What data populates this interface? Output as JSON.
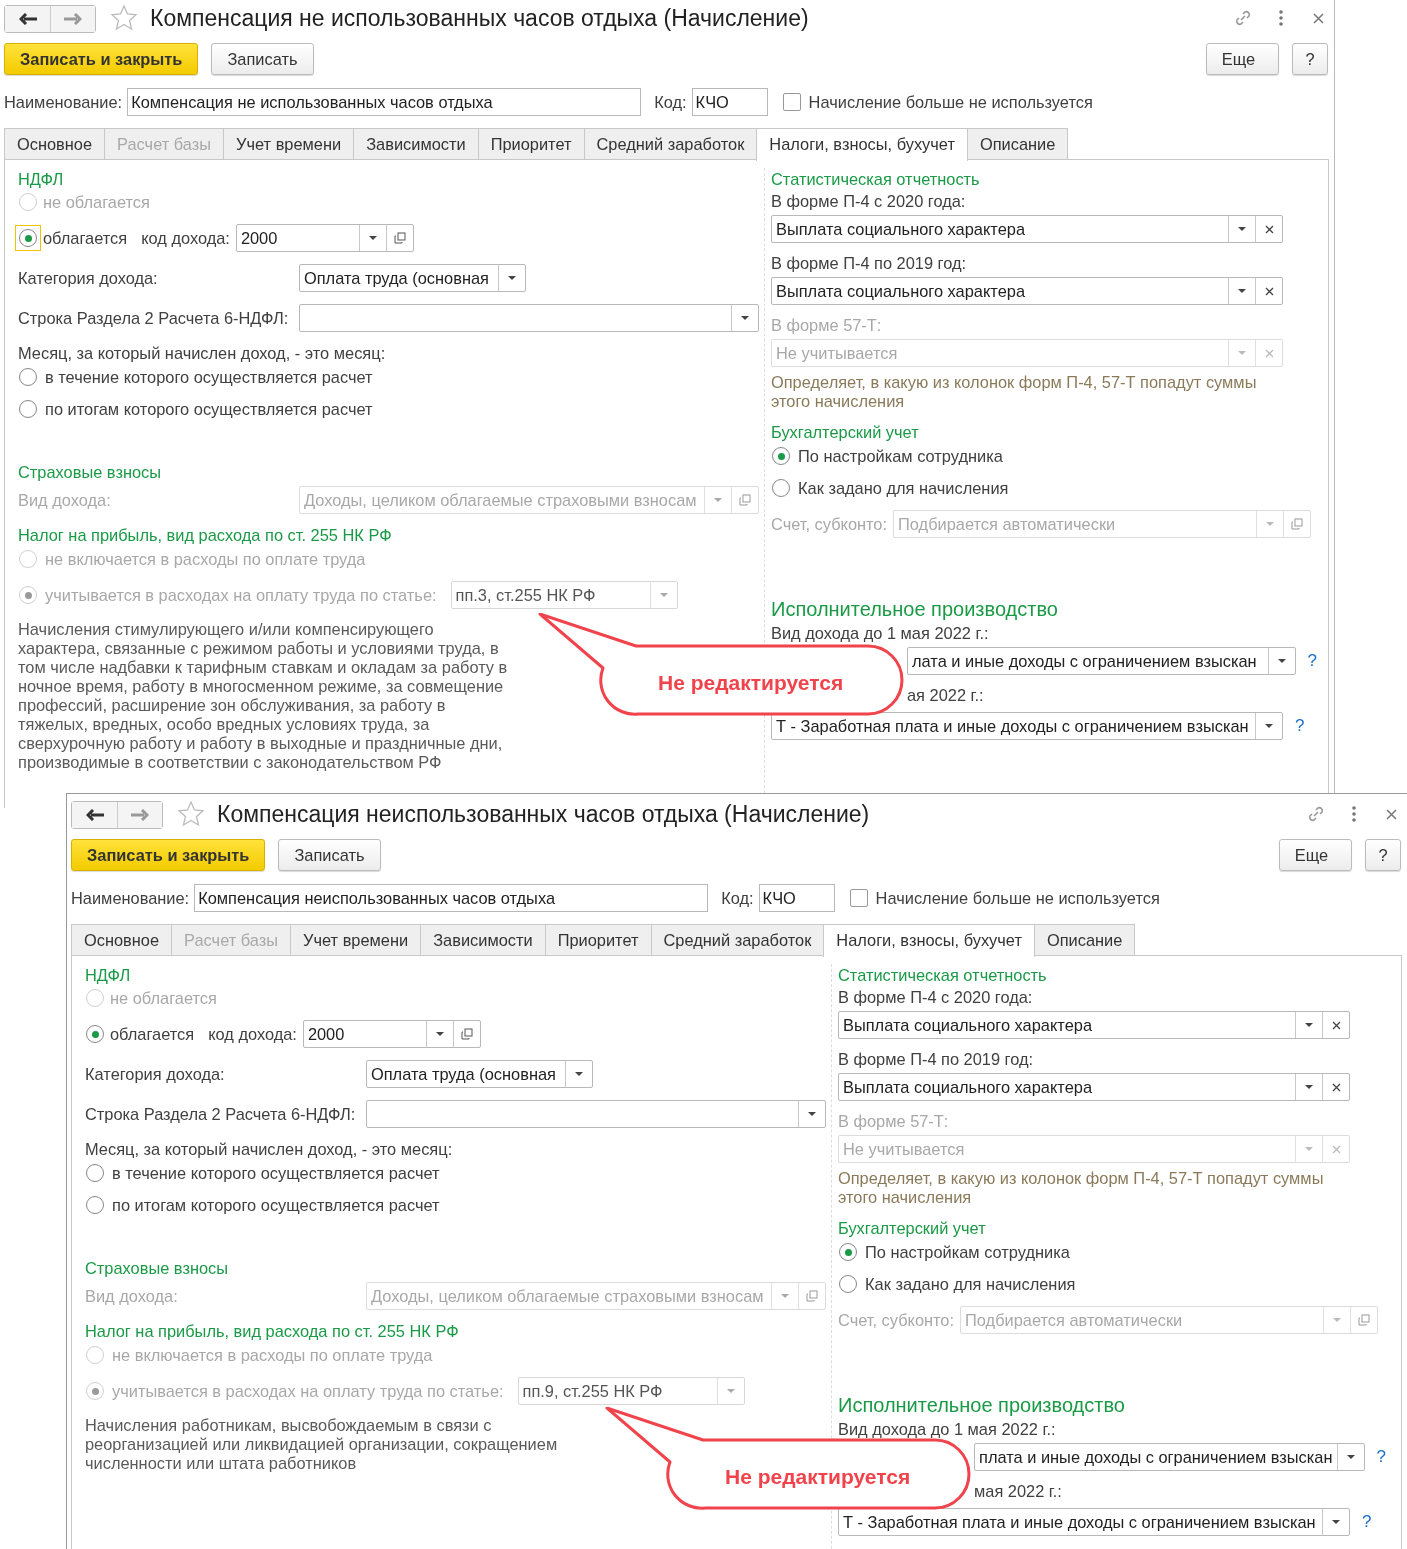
{
  "windows": [
    {
      "title": "Компенсация не использованных часов отдыха (Начисление)",
      "buttons": {
        "save_close": "Записать и закрыть",
        "save": "Записать",
        "more": "Еще",
        "help": "?"
      },
      "name": {
        "label": "Наименование:",
        "value": "Компенсация не использованных часов отдыха"
      },
      "code": {
        "label": "Код:",
        "value": "КЧО"
      },
      "not_used": {
        "label": "Начисление больше не используется",
        "checked": false
      },
      "tabs": [
        {
          "label": "Основное",
          "selected": false,
          "disabled": false
        },
        {
          "label": "Расчет базы",
          "selected": false,
          "disabled": true
        },
        {
          "label": "Учет времени",
          "selected": false,
          "disabled": false
        },
        {
          "label": "Зависимости",
          "selected": false,
          "disabled": false
        },
        {
          "label": "Приоритет",
          "selected": false,
          "disabled": false
        },
        {
          "label": "Средний заработок",
          "selected": false,
          "disabled": false
        },
        {
          "label": "Налоги, взносы, бухучет",
          "selected": true,
          "disabled": false
        },
        {
          "label": "Описание",
          "selected": false,
          "disabled": false
        }
      ],
      "ndfl": {
        "heading": "НДФЛ",
        "options": [
          {
            "label": "не облагается",
            "selected": false,
            "disabled": true,
            "focused": false
          },
          {
            "label": "облагается",
            "selected": true,
            "disabled": false,
            "focused": true
          }
        ],
        "income_code": {
          "label": "код дохода:",
          "value": "2000"
        },
        "category": {
          "label": "Категория дохода:",
          "value": "Оплата труда (основная"
        },
        "line": {
          "label": "Строка Раздела 2 Расчета 6-НДФЛ:"
        },
        "month": {
          "label": "Месяц, за который начислен доход, - это месяц:",
          "options": [
            {
              "label": "в течение которого осуществляется расчет",
              "selected": false
            },
            {
              "label": "по итогам которого осуществляется расчет",
              "selected": false
            }
          ]
        }
      },
      "insurance": {
        "heading": "Страховые взносы",
        "label": "Вид дохода:",
        "value": "Доходы, целиком облагаемые страховыми взносам"
      },
      "profit_tax": {
        "heading": "Налог на прибыль, вид расхода по ст. 255 НК РФ",
        "options": [
          {
            "label": "не включается в расходы по оплате труда",
            "selected": false,
            "disabled": true
          },
          {
            "label": "учитывается в расходах на оплату труда по статье:",
            "selected": true,
            "disabled": true
          }
        ],
        "article": "пп.3, ст.255 НК РФ",
        "description": "Начисления стимулирующего и/или компенсирующего характера, связанные с режимом работы и условиями труда, в том числе надбавки к тарифным ставкам и окладам за работу в ночное время, работу в многосменном режиме, за совмещение профессий, расширение зон обслуживания, за работу в тяжелых, вредных, особо вредных условиях труда, за сверхурочную работу и работу в выходные и праздничные дни, производимые в соответствии с законодательством РФ"
      },
      "stats": {
        "heading": "Статистическая отчетность",
        "fields": [
          {
            "label": "В форме П-4 с 2020 года:",
            "value": "Выплата социального характера",
            "disabled": false
          },
          {
            "label": "В форме П-4 по 2019 год:",
            "value": "Выплата социального характера",
            "disabled": false
          },
          {
            "label": "В форме 57-Т:",
            "value": "Не учитывается",
            "disabled": true
          }
        ],
        "note": "Определяет, в какую из колонок форм П-4, 57-Т попадут суммы этого начисления"
      },
      "accounting": {
        "heading": "Бухгалтерский учет",
        "options": [
          {
            "label": "По настройкам сотрудника",
            "selected": true
          },
          {
            "label": "Как задано для начисления",
            "selected": false
          }
        ],
        "account": {
          "label": "Счет, субконто:",
          "value": "Подбирается автоматически",
          "disabled": true
        }
      },
      "enforcement": {
        "heading": "Исполнительное производство",
        "fields": [
          {
            "label": "Вид дохода до 1 мая 2022 г.:",
            "value": "лата и иные доходы с ограничением взыскан",
            "help": "?"
          },
          {
            "label": "ая 2022 г.:",
            "value": "Т - Заработная плата и иные доходы с ограничением взыскан",
            "help": "?"
          }
        ]
      },
      "callout": "Не редактируется"
    },
    {
      "title": "Компенсация неиспользованных часов отдыха (Начисление)",
      "buttons": {
        "save_close": "Записать и закрыть",
        "save": "Записать",
        "more": "Еще",
        "help": "?"
      },
      "name": {
        "label": "Наименование:",
        "value": "Компенсация неиспользованных часов отдыха"
      },
      "code": {
        "label": "Код:",
        "value": "КЧО"
      },
      "not_used": {
        "label": "Начисление больше не используется",
        "checked": false
      },
      "tabs": [
        {
          "label": "Основное",
          "selected": false,
          "disabled": false
        },
        {
          "label": "Расчет базы",
          "selected": false,
          "disabled": true
        },
        {
          "label": "Учет времени",
          "selected": false,
          "disabled": false
        },
        {
          "label": "Зависимости",
          "selected": false,
          "disabled": false
        },
        {
          "label": "Приоритет",
          "selected": false,
          "disabled": false
        },
        {
          "label": "Средний заработок",
          "selected": false,
          "disabled": false
        },
        {
          "label": "Налоги, взносы, бухучет",
          "selected": true,
          "disabled": false
        },
        {
          "label": "Описание",
          "selected": false,
          "disabled": false
        }
      ],
      "ndfl": {
        "heading": "НДФЛ",
        "options": [
          {
            "label": "не облагается",
            "selected": false,
            "disabled": true,
            "focused": false
          },
          {
            "label": "облагается",
            "selected": true,
            "disabled": false,
            "focused": false
          }
        ],
        "income_code": {
          "label": "код дохода:",
          "value": "2000"
        },
        "category": {
          "label": "Категория дохода:",
          "value": "Оплата труда (основная"
        },
        "line": {
          "label": "Строка Раздела 2 Расчета 6-НДФЛ:"
        },
        "month": {
          "label": "Месяц, за который начислен доход, - это месяц:",
          "options": [
            {
              "label": "в течение которого осуществляется расчет",
              "selected": false
            },
            {
              "label": "по итогам которого осуществляется расчет",
              "selected": false
            }
          ]
        }
      },
      "insurance": {
        "heading": "Страховые взносы",
        "label": "Вид дохода:",
        "value": "Доходы, целиком облагаемые страховыми взносам"
      },
      "profit_tax": {
        "heading": "Налог на прибыль, вид расхода по ст. 255 НК РФ",
        "options": [
          {
            "label": "не включается в расходы по оплате труда",
            "selected": false,
            "disabled": true
          },
          {
            "label": "учитывается в расходах на оплату труда по статье:",
            "selected": true,
            "disabled": true
          }
        ],
        "article": "пп.9, ст.255 НК РФ",
        "description": "Начисления работникам, высвобождаемым в связи с реорганизацией или ликвидацией организации, сокращением численности или штата работников"
      },
      "stats": {
        "heading": "Статистическая отчетность",
        "fields": [
          {
            "label": "В форме П-4 с 2020 года:",
            "value": "Выплата социального характера",
            "disabled": false
          },
          {
            "label": "В форме П-4 по 2019 год:",
            "value": "Выплата социального характера",
            "disabled": false
          },
          {
            "label": "В форме 57-Т:",
            "value": "Не учитывается",
            "disabled": true
          }
        ],
        "note": "Определяет, в какую из колонок форм П-4, 57-Т попадут суммы этого начисления"
      },
      "accounting": {
        "heading": "Бухгалтерский учет",
        "options": [
          {
            "label": "По настройкам сотрудника",
            "selected": true
          },
          {
            "label": "Как задано для начисления",
            "selected": false
          }
        ],
        "account": {
          "label": "Счет, субконто:",
          "value": "Подбирается автоматически",
          "disabled": true
        }
      },
      "enforcement": {
        "heading": "Исполнительное производство",
        "fields": [
          {
            "label": "Вид дохода до 1 мая 2022 г.:",
            "value": "плата и иные доходы с ограничением взыскан",
            "help": "?"
          },
          {
            "label": "мая 2022 г.:",
            "value": "Т - Заработная плата и иные доходы с ограничением взыскан",
            "help": "?"
          }
        ]
      },
      "callout": "Не редактируется"
    }
  ]
}
